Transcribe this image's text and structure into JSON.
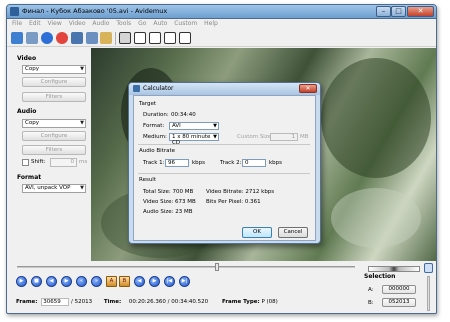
{
  "window": {
    "title": "Финал - Кубок Абзаково '05.avi - Avidemux"
  },
  "menu": [
    "File",
    "Edit",
    "View",
    "Video",
    "Audio",
    "Tools",
    "Go",
    "Auto",
    "Custom",
    "Help"
  ],
  "sidebar": {
    "video_title": "Video",
    "video_codec": "Copy",
    "video_configure": "Configure",
    "video_filters": "Filters",
    "audio_title": "Audio",
    "audio_codec": "Copy",
    "audio_configure": "Configure",
    "audio_filters": "Filters",
    "shift_label": "Shift:",
    "shift_value": "0",
    "shift_unit": "ms",
    "format_title": "Format",
    "format_value": "AVI, unpack VOP"
  },
  "status": {
    "frame_label": "Frame:",
    "frame_value": "30659",
    "frame_total": "/ 52013",
    "time_label": "Time:",
    "time_value": "00:20:26.360",
    "time_total": "/ 00:34:40.520",
    "frame_type_label": "Frame Type:",
    "frame_type_value": "P (08)"
  },
  "selection": {
    "title": "Selection",
    "a_label": "A:",
    "a_value": "000000",
    "b_label": "B:",
    "b_value": "052013"
  },
  "calculator": {
    "title": "Calculator",
    "target_header": "Target",
    "duration_label": "Duration:",
    "duration_value": "00:34:40",
    "format_label": "Format:",
    "format_value": "AVI",
    "medium_label": "Medium:",
    "medium_value": "1 x 80 minute CD",
    "custom_size_label": "Custom Size:",
    "custom_size_value": "1",
    "custom_size_unit": "MB",
    "audio_bitrate_header": "Audio Bitrate",
    "track1_label": "Track 1:",
    "track1_value": "96",
    "track1_unit": "kbps",
    "track2_label": "Track 2:",
    "track2_value": "0",
    "track2_unit": "kbps",
    "result_header": "Result",
    "total_size": "Total Size:   700  MB",
    "video_size": "Video Size:   673  MB",
    "audio_size": "Audio Size:    23  MB",
    "video_bitrate": "Video Bitrate:  2712  kbps",
    "bits_per_pixel": "Bits Per Pixel:  0.361",
    "ok_label": "OK",
    "cancel_label": "Cancel"
  }
}
